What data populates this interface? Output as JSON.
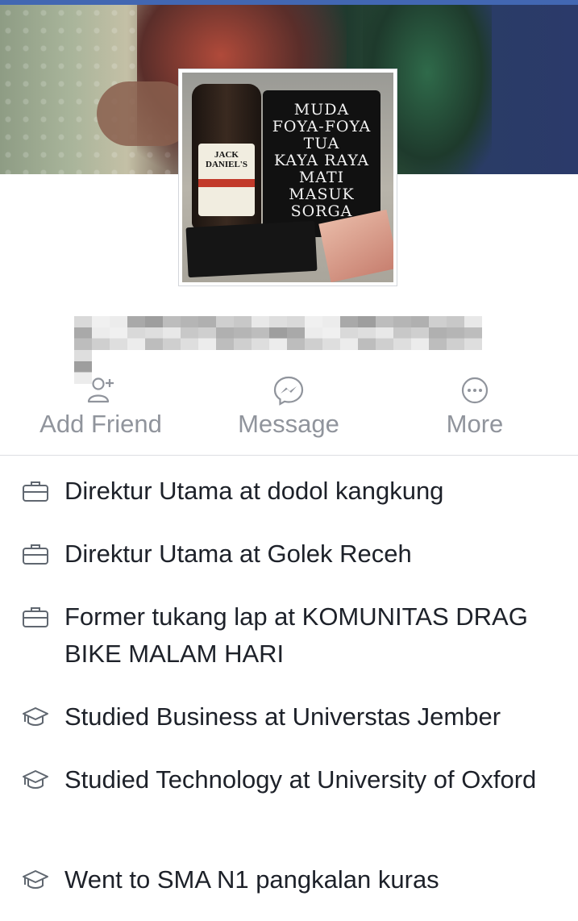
{
  "cover": {
    "alt": "cover photo"
  },
  "profile": {
    "name": "",
    "avatar_text": [
      "MUDA",
      "FOYA-FOYA",
      "TUA",
      "KAYA RAYA",
      "MATI",
      "MASUK SORGA"
    ],
    "bottle_label": "JACK DANIEL'S"
  },
  "actions": [
    {
      "label": "Add Friend",
      "icon": "add-friend-icon"
    },
    {
      "label": "Message",
      "icon": "messenger-icon"
    },
    {
      "label": "More",
      "icon": "more-icon"
    }
  ],
  "about": [
    {
      "icon": "work-icon",
      "text": "Direktur Utama at dodol kangkung"
    },
    {
      "icon": "work-icon",
      "text": "Direktur Utama at Golek Receh"
    },
    {
      "icon": "work-icon",
      "text": "Former tukang lap at KOMUNITAS DRAG BIKE MALAM HARI"
    },
    {
      "icon": "education-icon",
      "text": "Studied Business at Universtas Jember"
    },
    {
      "icon": "education-icon",
      "text": "Studied Technology at University of Oxford"
    },
    {
      "icon": "education-icon",
      "text": "Went to SMA N1 pangkalan kuras"
    }
  ],
  "colors": {
    "text": "#1d2129",
    "muted": "#90949c",
    "brand": "#4267b2",
    "divider": "#dddfe2"
  }
}
